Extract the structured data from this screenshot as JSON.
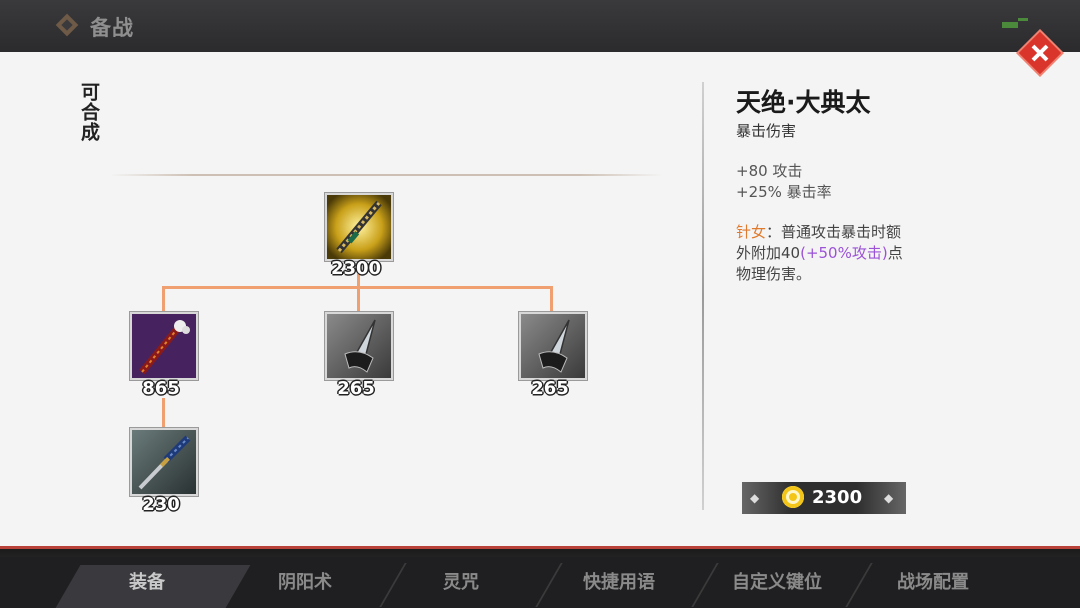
{
  "header": {
    "title": "备战"
  },
  "panel": {
    "craftable_label": "可合成"
  },
  "tree": {
    "root": {
      "price": "2300",
      "icon": "golden-katana-icon"
    },
    "level1": [
      {
        "price": "865",
        "icon": "purple-bone-sword-icon"
      },
      {
        "price": "265",
        "icon": "dagger-blade-icon"
      },
      {
        "price": "265",
        "icon": "dagger-blade-icon"
      }
    ],
    "level2": [
      {
        "price": "230",
        "icon": "blue-katana-icon"
      }
    ]
  },
  "detail": {
    "name": "天绝·大典太",
    "subtitle": "暴击伤害",
    "stats": [
      "+80 攻击",
      "+25% 暴击率"
    ],
    "passive_owner": "针女",
    "passive_text_1": "：普通攻击暴击时额外附加40",
    "passive_scale": "(+50%攻击)",
    "passive_text_2": "点物理伤害。",
    "cost": "2300"
  },
  "tabs": [
    {
      "label": "装备"
    },
    {
      "label": "阴阳术"
    },
    {
      "label": "灵咒"
    },
    {
      "label": "快捷用语"
    },
    {
      "label": "自定义键位"
    },
    {
      "label": "战场配置"
    }
  ],
  "colors": {
    "accent_red": "#d9352b",
    "connector": "#f0a070",
    "passive_owner": "#e07a2d",
    "passive_scale": "#9b52d6",
    "coin": "#f3c518"
  }
}
